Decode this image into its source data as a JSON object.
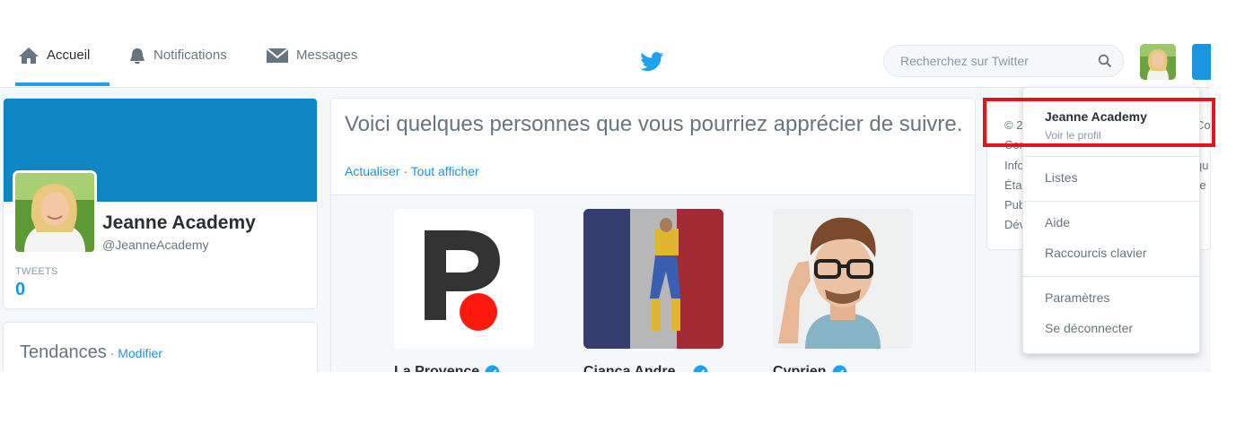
{
  "nav": {
    "home_label": "Accueil",
    "notifications_label": "Notifications",
    "messages_label": "Messages"
  },
  "search": {
    "placeholder": "Recherchez sur Twitter"
  },
  "profile": {
    "name": "Jeanne Academy",
    "handle": "@JeanneAcademy",
    "tweets_label": "TWEETS",
    "tweets_count": "0"
  },
  "trends": {
    "title": "Tendances",
    "separator": " · ",
    "edit_label": "Modifier"
  },
  "suggestions": {
    "title": "Voici quelques personnes que vous pourriez apprécier de suivre.",
    "refresh_label": "Actualiser",
    "separator": " · ",
    "view_all_label": "Tout afficher",
    "accounts": [
      {
        "name": "La Provence"
      },
      {
        "name": "Cianca Andre..."
      },
      {
        "name": "Cyprien"
      }
    ]
  },
  "footer": {
    "lines": [
      "© 2",
      "Con",
      "Info",
      "Éta",
      "Pub",
      "Dév"
    ],
    "right_lines": [
      "Co",
      "qu",
      "re"
    ]
  },
  "dropdown": {
    "profile_name": "Jeanne Academy",
    "view_profile_label": "Voir le profil",
    "lists_label": "Listes",
    "help_label": "Aide",
    "shortcuts_label": "Raccourcis clavier",
    "settings_label": "Paramètres",
    "logout_label": "Se déconnecter"
  },
  "colors": {
    "brand_blue": "#1da1f2",
    "link_blue": "#1b95e0",
    "banner_blue": "#0e86c4",
    "highlight_red": "#e3141c"
  }
}
